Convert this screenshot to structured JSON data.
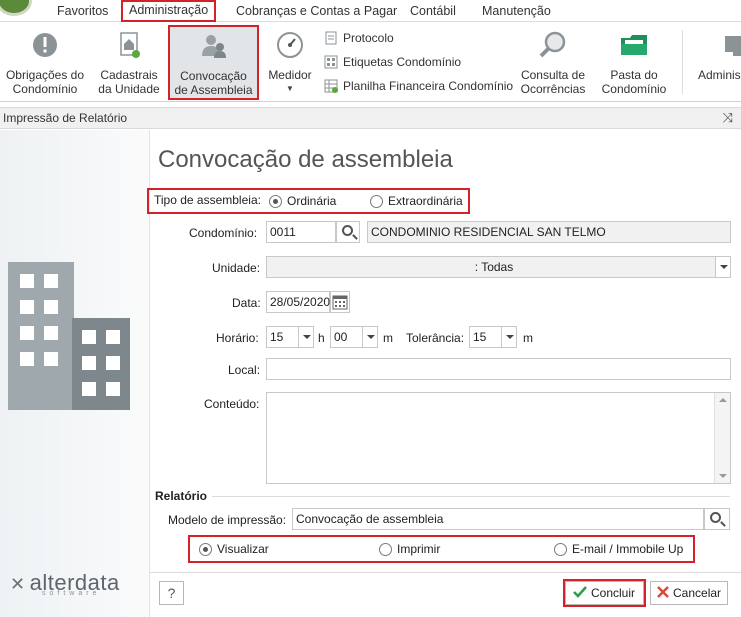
{
  "menu": {
    "items": [
      {
        "label": "Favoritos"
      },
      {
        "label": "Administração"
      },
      {
        "label": "Cobranças e Contas a Pagar"
      },
      {
        "label": "Contábil"
      },
      {
        "label": "Manutenção"
      }
    ]
  },
  "ribbon": {
    "obrigacoes": {
      "line1": "Obrigações do",
      "line2": "Condomínio"
    },
    "cadastrais": {
      "line1": "Cadastrais",
      "line2": "da Unidade"
    },
    "convocacao": {
      "line1": "Convocação",
      "line2": "de Assembleia"
    },
    "medidor": {
      "line1": "Medidor"
    },
    "protocolo": "Protocolo",
    "etiquetas": "Etiquetas Condomínio",
    "planilha": "Planilha Financeira Condomínio",
    "consulta": {
      "line1": "Consulta de",
      "line2": "Ocorrências"
    },
    "pasta": {
      "line1": "Pasta do",
      "line2": "Condomínio"
    },
    "admin": {
      "line1": "Adminis"
    }
  },
  "window": {
    "title": "Impressão de Relatório"
  },
  "form": {
    "title": "Convocação de assembleia",
    "tipo_label": "Tipo de assembleia:",
    "tipo_options": [
      "Ordinária",
      "Extraordinária"
    ],
    "condominio_label": "Condomínio:",
    "condominio_code": "0011",
    "condominio_name": "CONDOMINIO RESIDENCIAL SAN TELMO",
    "unidade_label": "Unidade:",
    "unidade_value": ": Todas",
    "data_label": "Data:",
    "data_value": "28/05/2020",
    "horario_label": "Horário:",
    "hora_value": "15",
    "h_unit": "h",
    "minuto_value": "00",
    "m_unit": "m",
    "tolerancia_label": "Tolerância:",
    "tolerancia_value": "15",
    "tol_unit": "m",
    "local_label": "Local:",
    "local_value": "",
    "conteudo_label": "Conteúdo:",
    "conteudo_value": ""
  },
  "relatorio": {
    "section_label": "Relatório",
    "modelo_label": "Modelo de impressão:",
    "modelo_value": "Convocação de assembleia",
    "output_options": [
      "Visualizar",
      "Imprimir",
      "E-mail / Immobile Up"
    ]
  },
  "buttons": {
    "help": "?",
    "concluir": "Concluir",
    "cancelar": "Cancelar"
  },
  "brand": {
    "name": "alterdata",
    "sub": "software"
  },
  "colors": {
    "highlight": "#d3222a",
    "accent_green": "#2e9c4a"
  }
}
